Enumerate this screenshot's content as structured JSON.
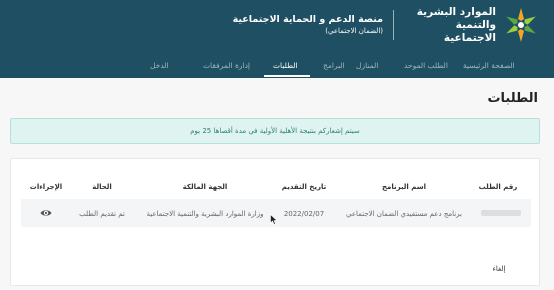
{
  "header": {
    "ministry_name": "الموارد البشرية والتنمية الاجتماعية",
    "platform_name": "منصة الدعم و الحماية الاجتماعية",
    "platform_subtitle": "(الضمان الاجتماعي)",
    "background_color": "#1f4f63"
  },
  "nav": {
    "items": [
      {
        "label": "الصفحة الرئيسية",
        "active": false
      },
      {
        "label": "الطلب الموحد",
        "active": false
      },
      {
        "label": "المنازل",
        "active": false
      },
      {
        "label": "البرامج",
        "active": false
      },
      {
        "label": "الطلبات",
        "active": true
      },
      {
        "label": "إدارة المرفقات",
        "active": false
      },
      {
        "label": "الدخل",
        "active": false
      }
    ]
  },
  "page": {
    "title": "الطلبات",
    "alert": "سيتم إشعاركم بنتيجة الأهلية الأولية في مدة أقصاها 25 يوم"
  },
  "table": {
    "headers": [
      "رقم الطلب",
      "اسم البرنامج",
      "تاريخ التقديم",
      "الجهة المالكة",
      "الحالة",
      "الإجراءات"
    ],
    "rows": [
      {
        "request_number": "",
        "program_name": "برنامج دعم مستفيدي الضمان الاجتماعي",
        "submission_date": "2022/02/07",
        "owner": "وزارة الموارد البشرية والتنمية الاجتماعية",
        "status": "تم تقديم الطلب",
        "action_icon": "eye-icon"
      }
    ]
  },
  "footer": {
    "cancel_label": "إلغاء"
  },
  "colors": {
    "accent": "#1f4f63",
    "alert_background": "#dff3f1",
    "alert_text": "#2f7f77"
  }
}
